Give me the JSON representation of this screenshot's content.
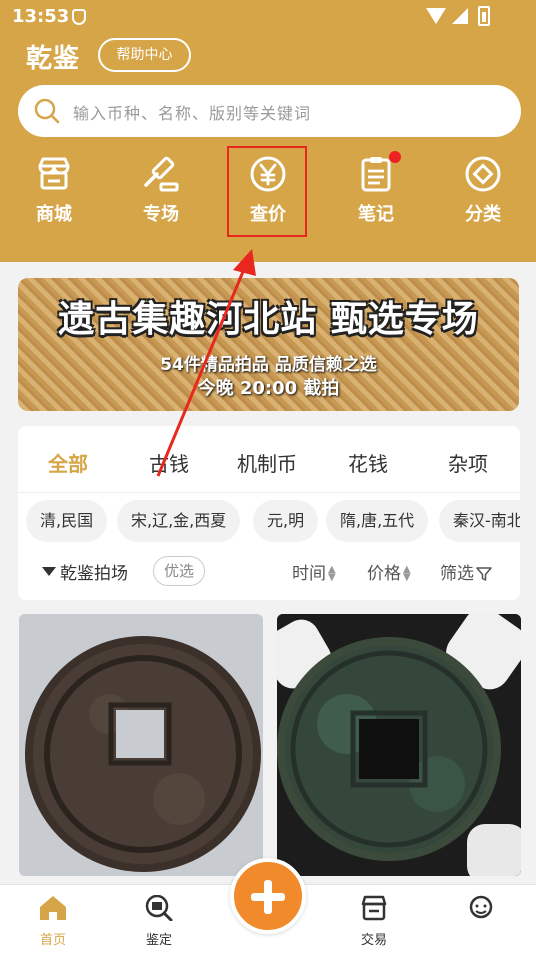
{
  "status": {
    "time": "13:53"
  },
  "header": {
    "app_title": "乾鉴",
    "help_label": "帮助中心"
  },
  "search": {
    "placeholder": "输入币种、名称、版别等关键词"
  },
  "nav": [
    {
      "label": "商城",
      "icon": "shop-icon"
    },
    {
      "label": "专场",
      "icon": "auction-hammer-icon"
    },
    {
      "label": "查价",
      "icon": "yen-price-icon"
    },
    {
      "label": "笔记",
      "icon": "notes-icon",
      "badge": true
    },
    {
      "label": "分类",
      "icon": "category-icon"
    }
  ],
  "banner": {
    "title": "遗古集趣河北站 甄选专场",
    "subtitle": "54件精品拍品 品质信赖之选",
    "time": "今晚 20:00 截拍"
  },
  "categories": {
    "items": [
      "全部",
      "古钱",
      "机制币",
      "花钱",
      "杂项"
    ],
    "active": "全部"
  },
  "eras": [
    "清,民国",
    "宋,辽,金,西夏",
    "元,明",
    "隋,唐,五代",
    "秦汉-南北"
  ],
  "sort": {
    "auction_label": "乾鉴拍场",
    "preferred_tag": "优选",
    "time_label": "时间",
    "price_label": "价格",
    "filter_label": "筛选"
  },
  "tabbar": {
    "home": "首页",
    "appraise": "鉴定",
    "trade": "交易"
  },
  "colors": {
    "accent": "#d6a548",
    "highlight": "#e8281e",
    "plus": "#f08a2a"
  }
}
